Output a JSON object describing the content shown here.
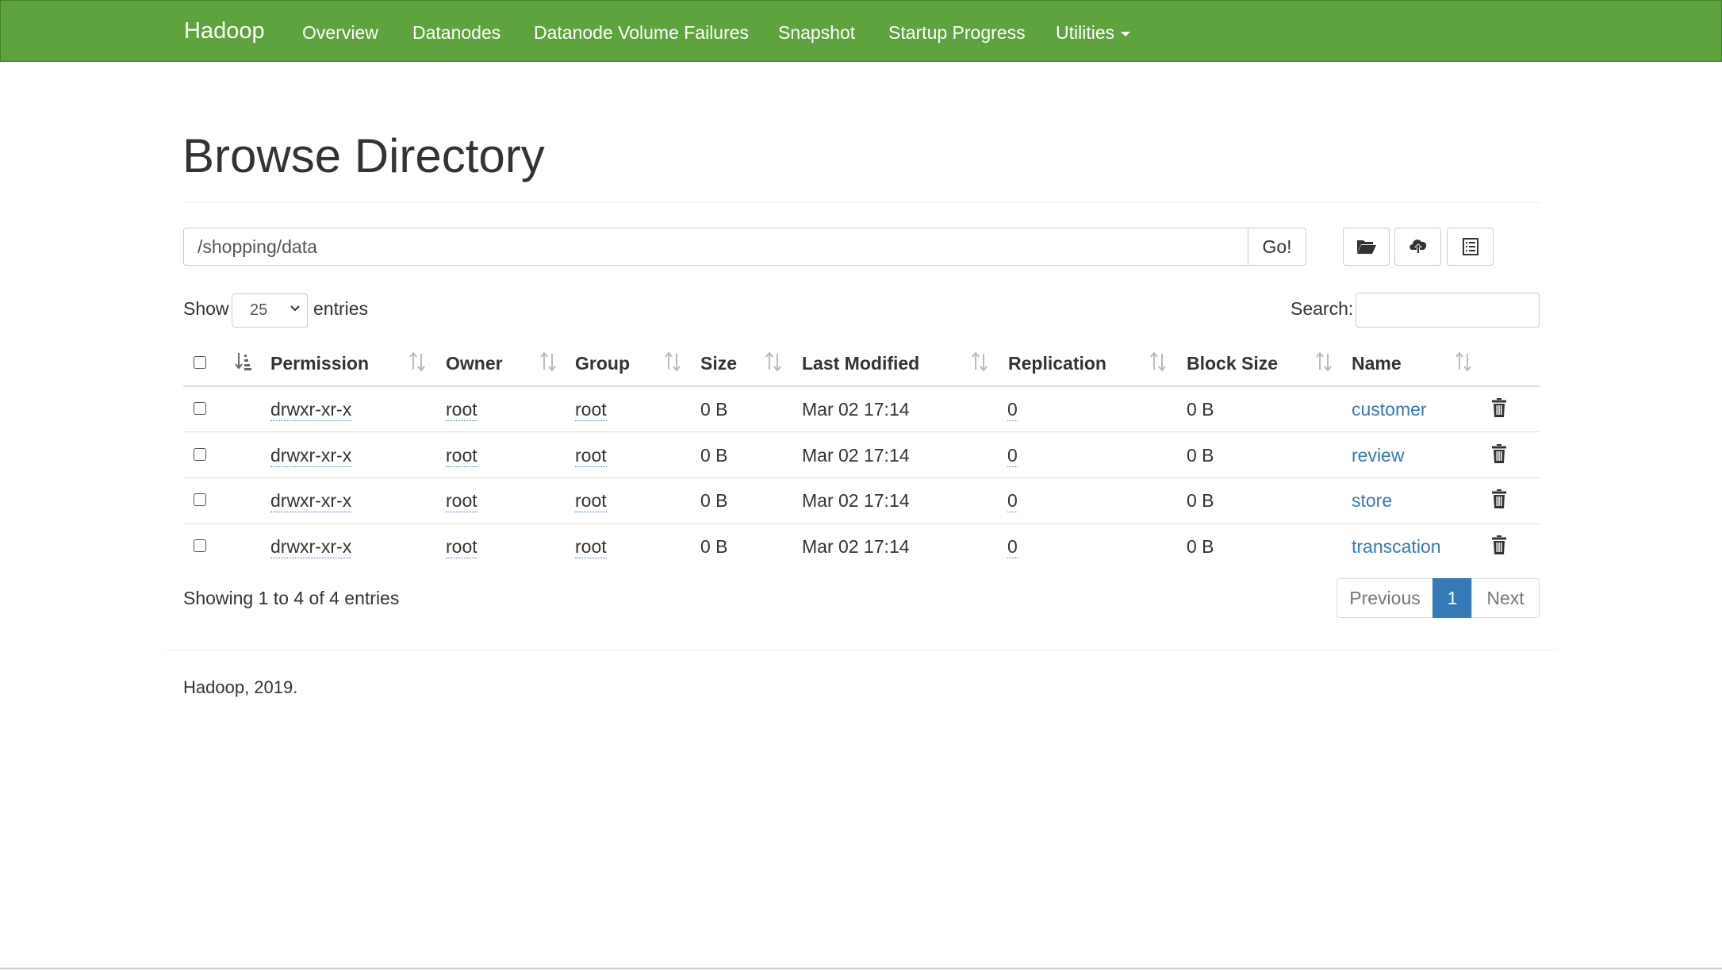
{
  "navbar": {
    "brand": "Hadoop",
    "links": [
      "Overview",
      "Datanodes",
      "Datanode Volume Failures",
      "Snapshot",
      "Startup Progress",
      "Utilities"
    ],
    "color": "#5fa33e"
  },
  "page": {
    "title": "Browse Directory"
  },
  "path_bar": {
    "value": "/shopping/data",
    "go_label": "Go!",
    "tool_icons": [
      "open-folder-icon",
      "upload-cloud-icon",
      "list-icon"
    ]
  },
  "table_controls": {
    "show_label": "Show",
    "page_length": "25",
    "entries_label": "entries",
    "search_label": "Search:",
    "search_value": ""
  },
  "table": {
    "columns": [
      "Permission",
      "Owner",
      "Group",
      "Size",
      "Last Modified",
      "Replication",
      "Block Size",
      "Name"
    ],
    "rows": [
      {
        "permission": "drwxr-xr-x",
        "owner": "root",
        "group": "root",
        "size": "0 B",
        "modified": "Mar 02 17:14",
        "replication": "0",
        "block_size": "0 B",
        "name": "customer"
      },
      {
        "permission": "drwxr-xr-x",
        "owner": "root",
        "group": "root",
        "size": "0 B",
        "modified": "Mar 02 17:14",
        "replication": "0",
        "block_size": "0 B",
        "name": "review"
      },
      {
        "permission": "drwxr-xr-x",
        "owner": "root",
        "group": "root",
        "size": "0 B",
        "modified": "Mar 02 17:14",
        "replication": "0",
        "block_size": "0 B",
        "name": "store"
      },
      {
        "permission": "drwxr-xr-x",
        "owner": "root",
        "group": "root",
        "size": "0 B",
        "modified": "Mar 02 17:14",
        "replication": "0",
        "block_size": "0 B",
        "name": "transcation"
      }
    ],
    "row_action_icon": "trash-icon"
  },
  "pagination": {
    "info": "Showing 1 to 4 of 4 entries",
    "previous": "Previous",
    "current": "1",
    "next": "Next",
    "accent": "#337ab7"
  },
  "footer": {
    "text": "Hadoop, 2019."
  }
}
